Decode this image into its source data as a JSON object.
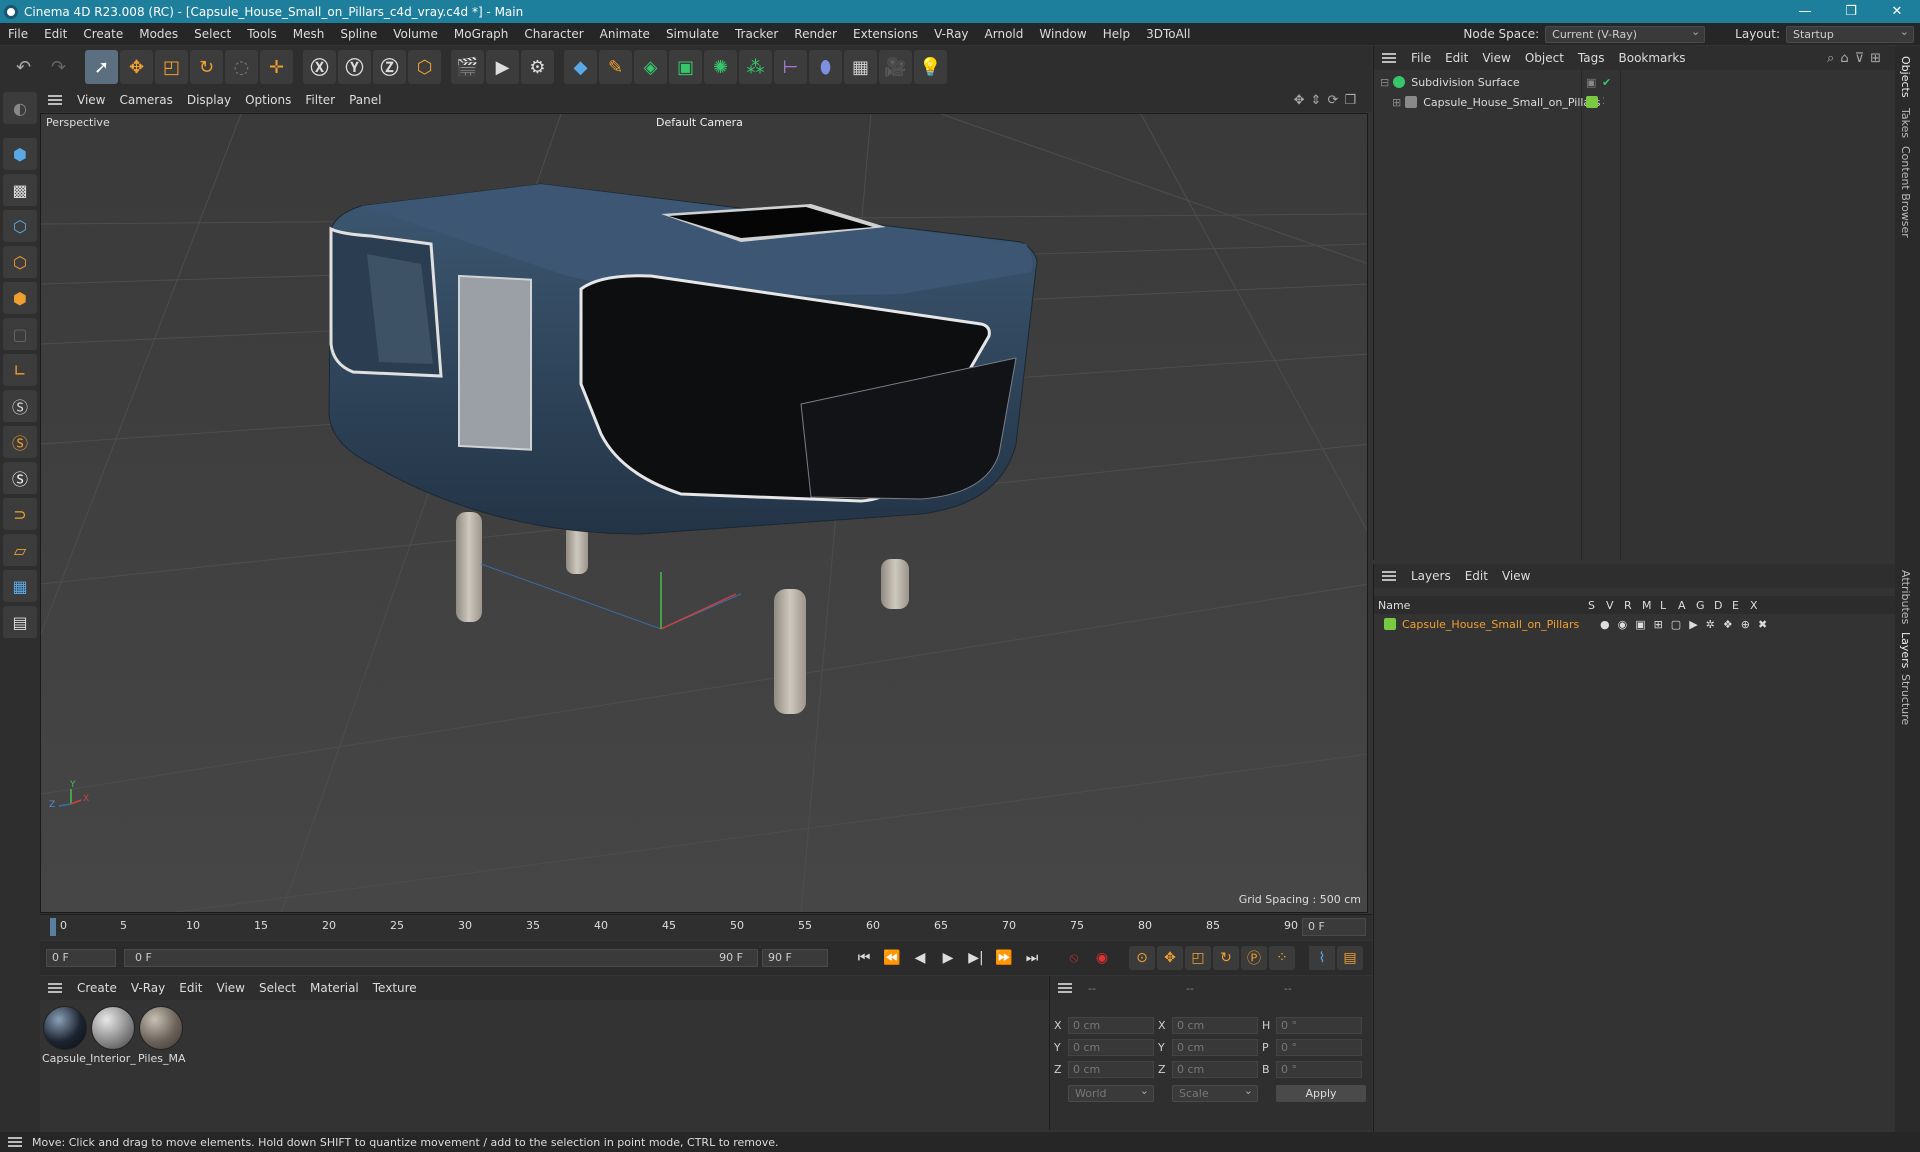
{
  "window": {
    "title": "Cinema 4D R23.008 (RC) - [Capsule_House_Small_on_Pillars_c4d_vray.c4d *] - Main",
    "controls": [
      "—",
      "❐",
      "✕"
    ]
  },
  "menu": [
    "File",
    "Edit",
    "Create",
    "Modes",
    "Select",
    "Tools",
    "Mesh",
    "Spline",
    "Volume",
    "MoGraph",
    "Character",
    "Animate",
    "Simulate",
    "Tracker",
    "Render",
    "Extensions",
    "V-Ray",
    "Arnold",
    "Window",
    "Help",
    "3DToAll"
  ],
  "nodespace": {
    "label": "Node Space:",
    "value": "Current (V-Ray)",
    "layout_label": "Layout:",
    "layout_value": "Startup"
  },
  "viewport_menu": [
    "View",
    "Cameras",
    "Display",
    "Options",
    "Filter",
    "Panel"
  ],
  "viewport": {
    "label": "Perspective",
    "camera": "Default Camera",
    "grid_spacing": "Grid Spacing : 500 cm",
    "axes": [
      "Y",
      "Z",
      "X"
    ]
  },
  "timeline": {
    "ticks": [
      "0",
      "5",
      "10",
      "15",
      "20",
      "25",
      "30",
      "35",
      "40",
      "45",
      "50",
      "55",
      "60",
      "65",
      "70",
      "75",
      "80",
      "85",
      "90"
    ],
    "frame_right": "0 F"
  },
  "transport": {
    "start": "0 F",
    "range_start": "0 F",
    "range_end": "90 F",
    "end": "90 F"
  },
  "material_menu": [
    "Create",
    "V-Ray",
    "Edit",
    "View",
    "Select",
    "Material",
    "Texture"
  ],
  "materials": [
    {
      "name": "Capsule_",
      "color": "#1c2430"
    },
    {
      "name": "Interior_",
      "color": "#8a8a8a"
    },
    {
      "name": "Piles_MA",
      "color": "#6b625a"
    }
  ],
  "coords": {
    "headers": [
      "--",
      "--",
      "--"
    ],
    "rows": [
      {
        "a": "X",
        "av": "0 cm",
        "b": "X",
        "bv": "0 cm",
        "c": "H",
        "cv": "0 °"
      },
      {
        "a": "Y",
        "av": "0 cm",
        "b": "Y",
        "bv": "0 cm",
        "c": "P",
        "cv": "0 °"
      },
      {
        "a": "Z",
        "av": "0 cm",
        "b": "Z",
        "bv": "0 cm",
        "c": "B",
        "cv": "0 °"
      }
    ],
    "space": "World",
    "mode": "Scale",
    "apply": "Apply"
  },
  "objects_menu": [
    "File",
    "Edit",
    "View",
    "Object",
    "Tags",
    "Bookmarks"
  ],
  "objects": [
    {
      "name": "Subdivision Surface",
      "color": "#36c76b"
    },
    {
      "name": "Capsule_House_Small_on_Pillars",
      "color": "#7ac943"
    }
  ],
  "layers_menu": [
    "Layers",
    "Edit",
    "View"
  ],
  "layers_header": {
    "name": "Name",
    "cols": [
      "S",
      "V",
      "R",
      "M",
      "L",
      "A",
      "G",
      "D",
      "E",
      "X"
    ]
  },
  "layers": [
    {
      "name": "Capsule_House_Small_on_Pillars",
      "color": "#7ac943"
    }
  ],
  "side_tabs": [
    "Objects",
    "Takes",
    "Content Browser",
    "Attributes",
    "Layers",
    "Structure"
  ],
  "status": "Move: Click and drag to move elements. Hold down SHIFT to quantize movement / add to the selection in point mode, CTRL to remove.",
  "colors": {
    "accent": "#1d7f9b",
    "orange": "#f0a030",
    "layer_text": "#f0a030"
  }
}
